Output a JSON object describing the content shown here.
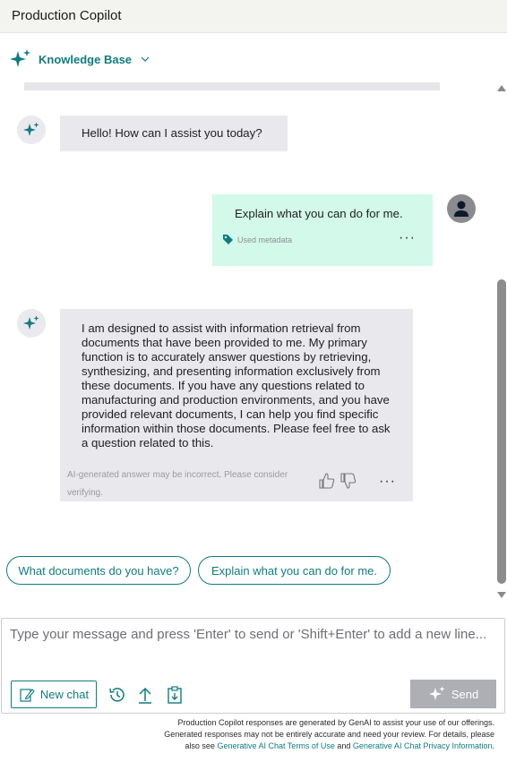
{
  "app": {
    "title": "Production Copilot"
  },
  "kb_selector": {
    "label": "Knowledge Base",
    "icon": "sparkle-icon"
  },
  "messages": {
    "greeting": {
      "text": "Hello! How can I assist you today?"
    },
    "user": {
      "text": "Explain what you can do for me.",
      "metadata_label": "Used metadata",
      "more": "···"
    },
    "answer": {
      "text": "I am designed to assist with information retrieval from documents that have been provided to me. My primary function is to accurately answer questions by retrieving, synthesizing, and presenting information exclusively from these documents. If you have any questions related to manufacturing and production environments, and you have provided relevant documents, I can help you find specific information within those documents. Please feel free to ask a question related to this.",
      "disclaimer": "AI-generated answer may be incorrect. Please consider verifying.",
      "more": "···"
    }
  },
  "suggestions": [
    "What documents do you have?",
    "Explain what you can do for me."
  ],
  "composer": {
    "placeholder": "Type your message and press 'Enter' to send or 'Shift+Enter' to add a new line...",
    "new_chat_label": "New chat",
    "send_label": "Send"
  },
  "footer": {
    "line1": "Production Copilot responses are generated by GenAI to assist your use of our offerings.",
    "line2": "Generated responses may not be entirely accurate and need your review. For details, please",
    "line3_prefix": "also see",
    "terms_link": "Generative AI Chat Terms of Use",
    "and": "and",
    "privacy_link": "Generative AI Chat Privacy Information",
    "period": "."
  },
  "colors": {
    "accent": "#0f7c80",
    "bot_bubble": "#e8e8ed",
    "user_bubble": "#d2f9ea",
    "send_disabled": "#aeaeb5"
  }
}
